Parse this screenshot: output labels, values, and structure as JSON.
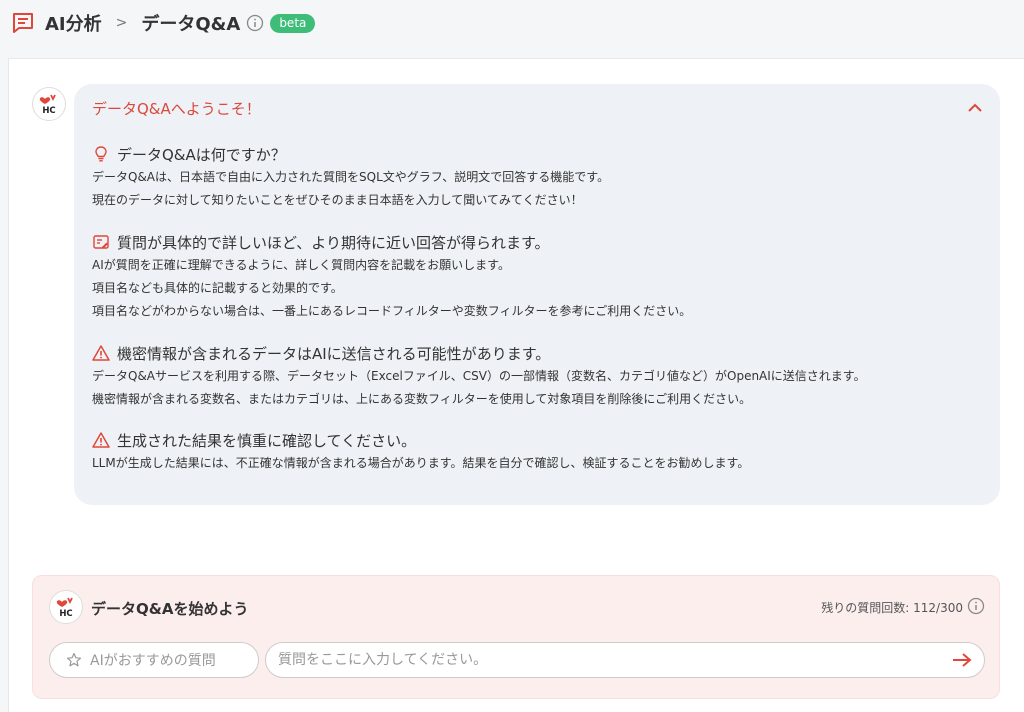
{
  "header": {
    "root": "AI分析",
    "separator": ">",
    "current": "データQ&A",
    "badge": "beta"
  },
  "welcome": {
    "title": "データQ&Aへようこそ！",
    "sections": [
      {
        "icon": "lightbulb-icon",
        "heading": "データQ&Aは何ですか？",
        "lines": [
          "データQ&Aは、日本語で自由に入力された質問をSQL文やグラフ、説明文で回答する機能です。",
          "現在のデータに対して知りたいことをぜひそのまま日本語を入力して聞いてみてください！"
        ]
      },
      {
        "icon": "document-edit-icon",
        "heading": "質問が具体的で詳しいほど、より期待に近い回答が得られます。",
        "lines": [
          "AIが質問を正確に理解できるように、詳しく質問内容を記載をお願いします。",
          "項目名なども具体的に記載すると効果的です。",
          "項目名などがわからない場合は、一番上にあるレコードフィルターや変数フィルターを参考にご利用ください。"
        ]
      },
      {
        "icon": "warning-icon",
        "heading": "機密情報が含まれるデータはAIに送信される可能性があります。",
        "lines": [
          "データQ&Aサービスを利用する際、データセット（Excelファイル、CSV）の一部情報（変数名、カテゴリ値など）がOpenAIに送信されます。",
          "機密情報が含まれる変数名、またはカテゴリは、上にある変数フィルターを使用して対象項目を削除後にご利用ください。"
        ]
      },
      {
        "icon": "warning-icon",
        "heading": "生成された結果を慎重に確認してください。",
        "lines": [
          "LLMが生成した結果には、不正確な情報が含まれる場合があります。結果を自分で確認し、検証することをお勧めします。"
        ]
      }
    ]
  },
  "composer": {
    "title": "データQ&Aを始めよう",
    "remaining": "残りの質問回数: 112/300",
    "suggest_label": "AIがおすすめの質問",
    "input_placeholder": "質問をここに入力してください。",
    "input_value": ""
  },
  "colors": {
    "accent": "#d94a3b",
    "badge": "#3ebd78",
    "welcome_bg": "#eef2f6",
    "composer_bg": "#fdeeee"
  }
}
